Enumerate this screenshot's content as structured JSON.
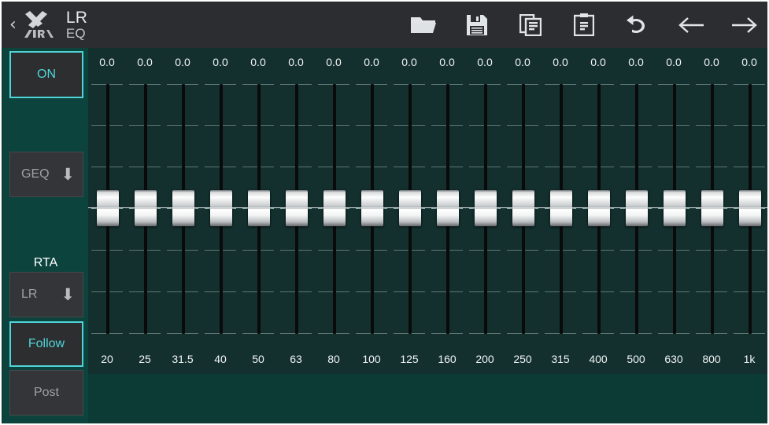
{
  "app": {
    "brand": "X AIR",
    "title": "LR",
    "subtitle": "EQ",
    "back_label": "‹"
  },
  "toolbar": {
    "items": [
      {
        "name": "open-icon",
        "label": "Open"
      },
      {
        "name": "save-icon",
        "label": "Save"
      },
      {
        "name": "copy-icon",
        "label": "Copy"
      },
      {
        "name": "paste-icon",
        "label": "Paste"
      },
      {
        "name": "undo-icon",
        "label": "Undo"
      },
      {
        "name": "back-arrow-icon",
        "label": "Back"
      },
      {
        "name": "forward-arrow-icon",
        "label": "Forward"
      }
    ]
  },
  "sidebar": {
    "on_button": {
      "label": "ON",
      "active": true
    },
    "geq_button": {
      "label": "GEQ",
      "arrow": "⬇"
    },
    "rta_label": "RTA",
    "rta_source_button": {
      "label": "LR",
      "arrow": "⬇"
    },
    "follow_button": {
      "label": "Follow",
      "active": true
    },
    "post_button": {
      "label": "Post",
      "active": false
    }
  },
  "colors": {
    "accent": "#4fd5d8",
    "panel_bg": "#13302f",
    "sidebar_bg": "#0c433c",
    "header_bg": "#2b2d30",
    "track": "#0a0a0a"
  },
  "geq": {
    "bands": [
      {
        "freq": "20",
        "value": "0.0"
      },
      {
        "freq": "25",
        "value": "0.0"
      },
      {
        "freq": "31.5",
        "value": "0.0"
      },
      {
        "freq": "40",
        "value": "0.0"
      },
      {
        "freq": "50",
        "value": "0.0"
      },
      {
        "freq": "63",
        "value": "0.0"
      },
      {
        "freq": "80",
        "value": "0.0"
      },
      {
        "freq": "100",
        "value": "0.0"
      },
      {
        "freq": "125",
        "value": "0.0"
      },
      {
        "freq": "160",
        "value": "0.0"
      },
      {
        "freq": "200",
        "value": "0.0"
      },
      {
        "freq": "250",
        "value": "0.0"
      },
      {
        "freq": "315",
        "value": "0.0"
      },
      {
        "freq": "400",
        "value": "0.0"
      },
      {
        "freq": "500",
        "value": "0.0"
      },
      {
        "freq": "630",
        "value": "0.0"
      },
      {
        "freq": "800",
        "value": "0.0"
      },
      {
        "freq": "1k",
        "value": "0.0"
      }
    ]
  }
}
